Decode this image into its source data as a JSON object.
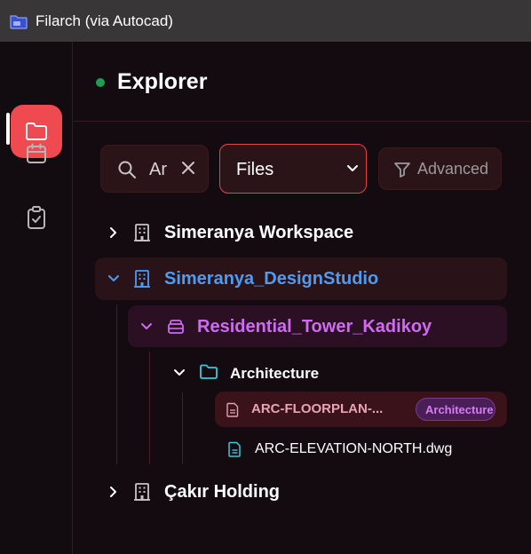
{
  "window": {
    "title": "Filarch (via Autocad)"
  },
  "rail": {
    "items": [
      {
        "icon": "folder-icon",
        "active": true
      },
      {
        "icon": "calendar-icon",
        "active": false
      },
      {
        "icon": "clipboard-check-icon",
        "active": false
      }
    ]
  },
  "header": {
    "title": "Explorer",
    "status_color": "#1f9d55"
  },
  "toolbar": {
    "search_value": "Ar",
    "scope_select": "Files",
    "advanced_label": "Advanced"
  },
  "tree": {
    "workspace_1": "Simeranya Workspace",
    "workspace_2": "Simeranya_DesignStudio",
    "project": "Residential_Tower_Kadikoy",
    "folder": "Architecture",
    "file_1": "ARC-FLOORPLAN-...",
    "file_1_badge": "Architecture",
    "file_2": "ARC-ELEVATION-NORTH.dwg",
    "workspace_3": "Çakır Holding"
  },
  "colors": {
    "accent": "#ef4a4f",
    "workspace_selected": "#4f9bf0",
    "project": "#cf6bf2",
    "folder_icon": "#3cc8dc"
  }
}
